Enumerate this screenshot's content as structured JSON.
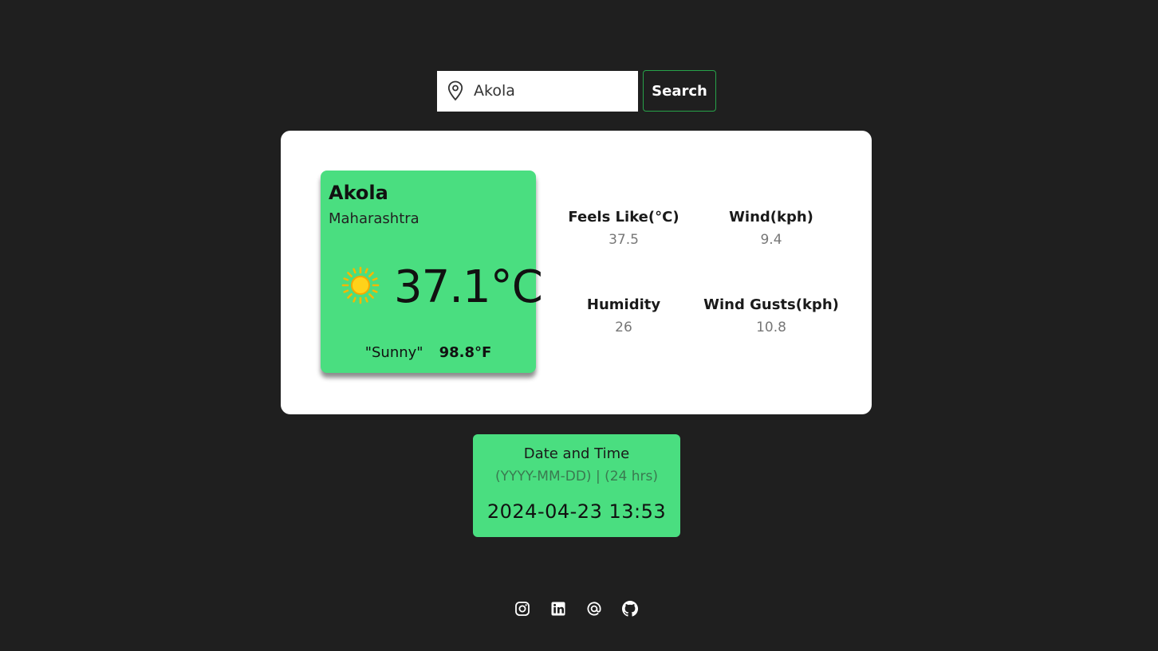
{
  "search": {
    "value": "Akola",
    "button_label": "Search",
    "icon": "map-pin-icon"
  },
  "weather": {
    "city": "Akola",
    "region": "Maharashtra",
    "temp_c": "37.1°C",
    "condition": "\"Sunny\"",
    "temp_f": "98.8°F",
    "condition_icon": "sun-icon"
  },
  "stats": {
    "feels_like": {
      "label": "Feels Like(°C)",
      "value": "37.5"
    },
    "wind": {
      "label": "Wind(kph)",
      "value": "9.4"
    },
    "humidity": {
      "label": "Humidity",
      "value": "26"
    },
    "wind_gusts": {
      "label": "Wind Gusts(kph)",
      "value": "10.8"
    }
  },
  "datetime": {
    "title": "Date and Time",
    "format": "(YYYY-MM-DD) | (24 hrs)",
    "value": "2024-04-23 13:53"
  },
  "footer": {
    "icons": [
      "instagram-icon",
      "linkedin-icon",
      "email-at-icon",
      "github-icon"
    ]
  },
  "colors": {
    "background": "#1f1f1f",
    "card": "#ffffff",
    "accent": "#4ade80",
    "button_border": "#27a249"
  }
}
